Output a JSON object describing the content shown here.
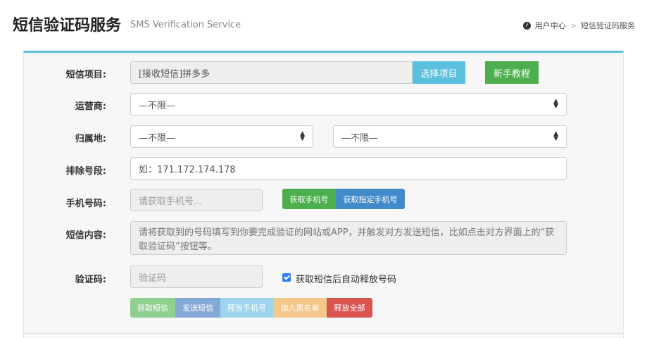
{
  "header": {
    "title": "短信验证码服务",
    "subtitle": "SMS Verification Service",
    "breadcrumb": {
      "home_icon": "dashboard-icon",
      "home_label": "用户中心",
      "separator": ">",
      "current": "短信验证码服务"
    }
  },
  "theme": {
    "accent": "#5bc0de",
    "green": "#4cae4c",
    "blue": "#428bca"
  },
  "form": {
    "project": {
      "label": "短信项目:",
      "value": "[接收短信]拼多多",
      "select_button": "选择项目",
      "tutorial_button": "新手教程"
    },
    "operator": {
      "label": "运营商:",
      "value": "—不限—"
    },
    "location": {
      "label": "归属地:",
      "province": "—不限—",
      "city": "—不限—"
    },
    "exclude": {
      "label": "排除号段:",
      "placeholder": "如：171.172.174.178"
    },
    "phone": {
      "label": "手机号码:",
      "placeholder": "请获取手机号...",
      "get_button": "获取手机号",
      "get_specific_button": "获取指定手机号"
    },
    "sms_content": {
      "label": "短信内容:",
      "placeholder": "请将获取到的号码填写到你要完成验证的网站或APP，并触发对方发送短信，比如点击对方界面上的“获取验证码”按钮等。"
    },
    "code": {
      "label": "验证码:",
      "placeholder": "验证码",
      "auto_release_checked": true,
      "auto_release_label": "获取短信后自动释放号码"
    },
    "actions": {
      "get_sms": "获取短信",
      "send_sms": "发送短信",
      "release_phone": "释放手机号",
      "blacklist": "加入黑名单",
      "release_all": "释放全部"
    }
  }
}
